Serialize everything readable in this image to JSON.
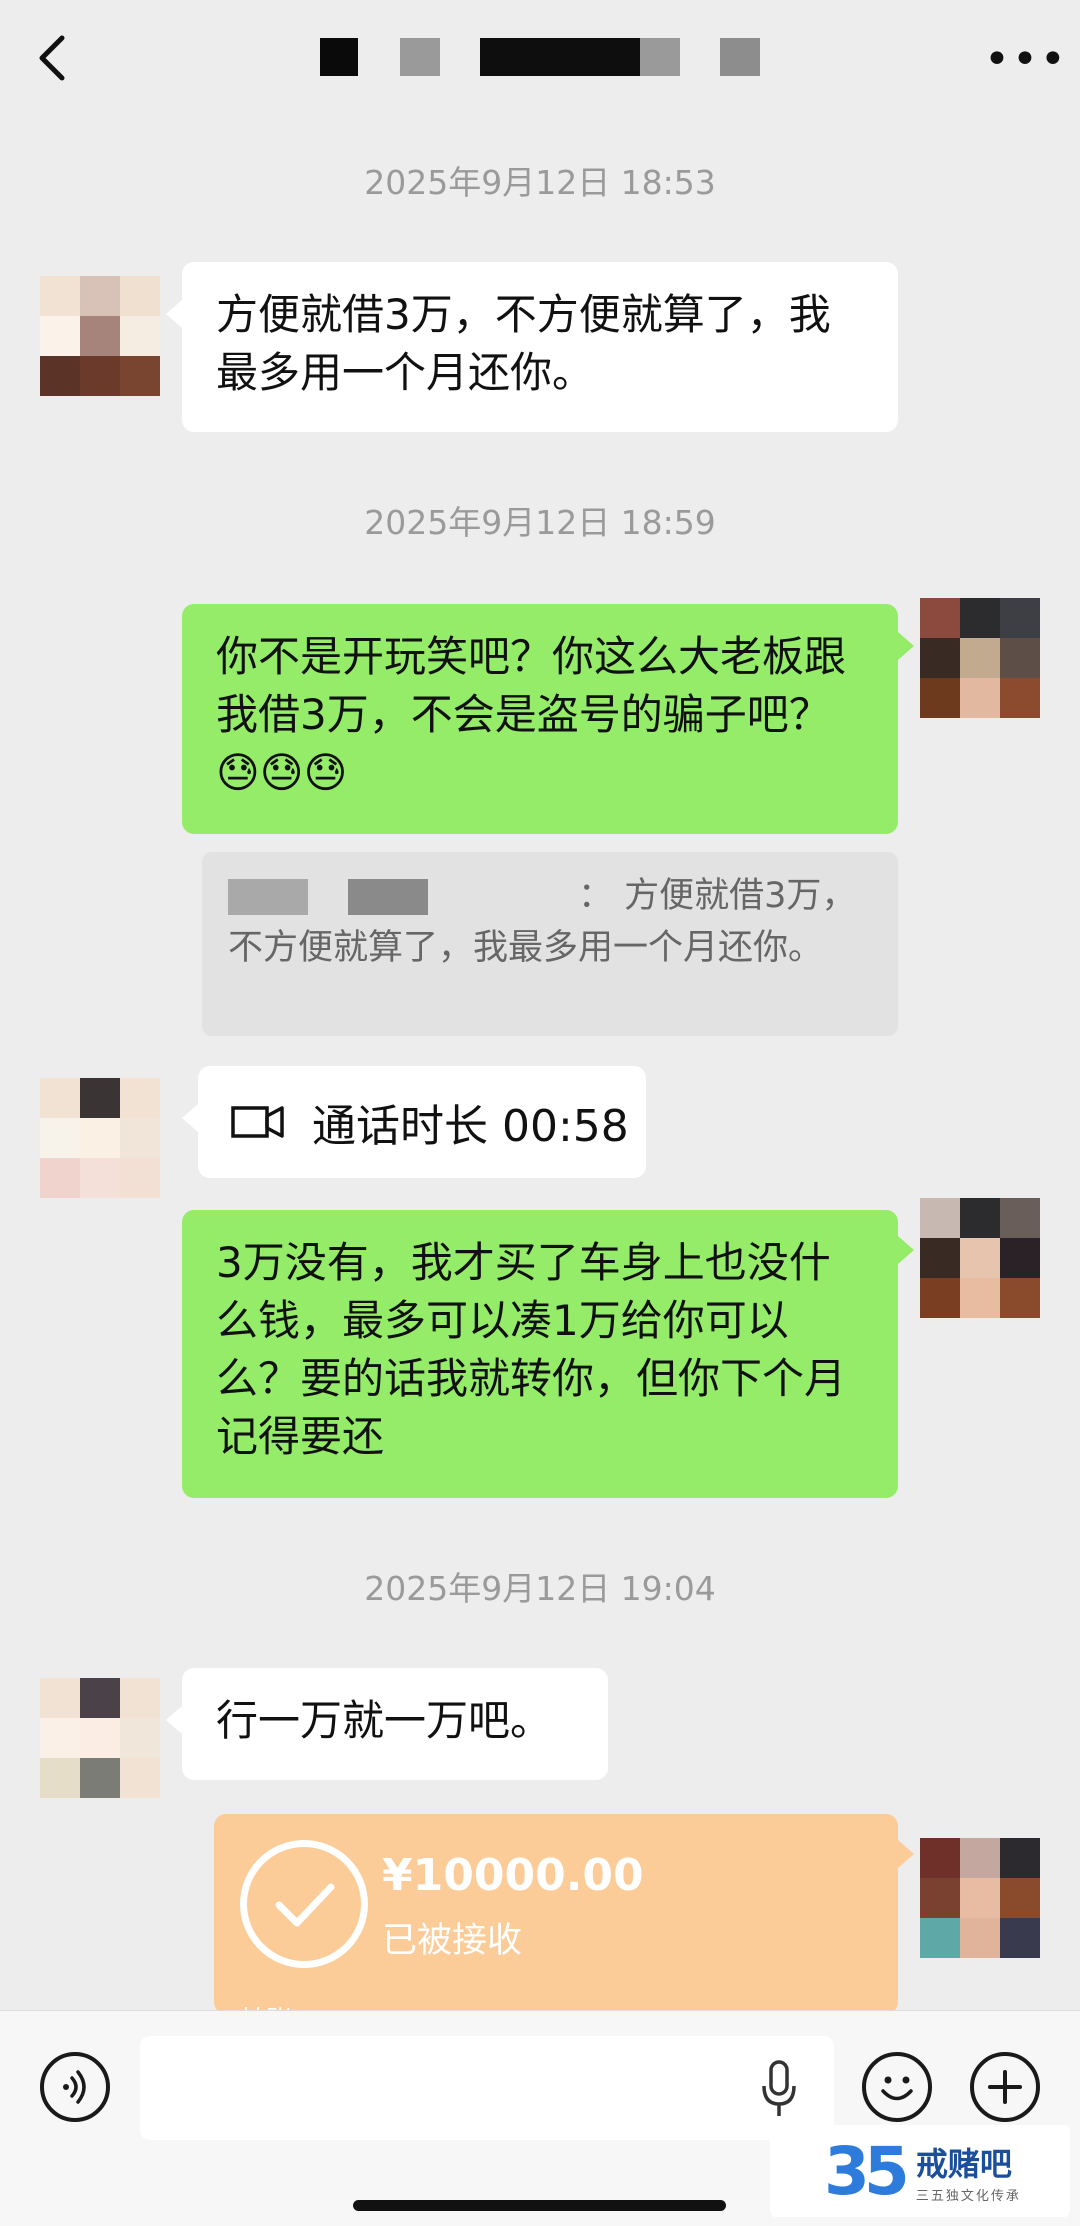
{
  "header": {
    "more_label": "•••"
  },
  "timestamps": [
    "2025年9月12日 18:53",
    "2025年9月12日 18:59",
    "2025年9月12日 19:04"
  ],
  "messages": {
    "m1": "方便就借3万，不方便就算了，我最多用一个月还你。",
    "m2": "你不是开玩笑吧？你这么大老板跟我借3万，不会是盗号的骗子吧？",
    "m2_emoji": "😓😓😓",
    "quote_text": "：  方便就借3万，不方便就算了，我最多用一个月还你。",
    "call_label": "通话时长 00:58",
    "m3": "3万没有，我才买了车身上也没什么钱，最多可以凑1万给你可以么？要的话我就转你，但你下个月记得要还",
    "m4": "行一万就一万吧。"
  },
  "transfer": {
    "amount": "¥10000.00",
    "status": "已被接收",
    "foot": "转账"
  },
  "watermark": {
    "number": "35",
    "brand": "戒赌吧",
    "tagline": "三五独文化传承"
  },
  "colors": {
    "background": "#ededed",
    "self_bubble": "#95ec69",
    "other_bubble": "#ffffff",
    "transfer": "#fbcb98"
  }
}
